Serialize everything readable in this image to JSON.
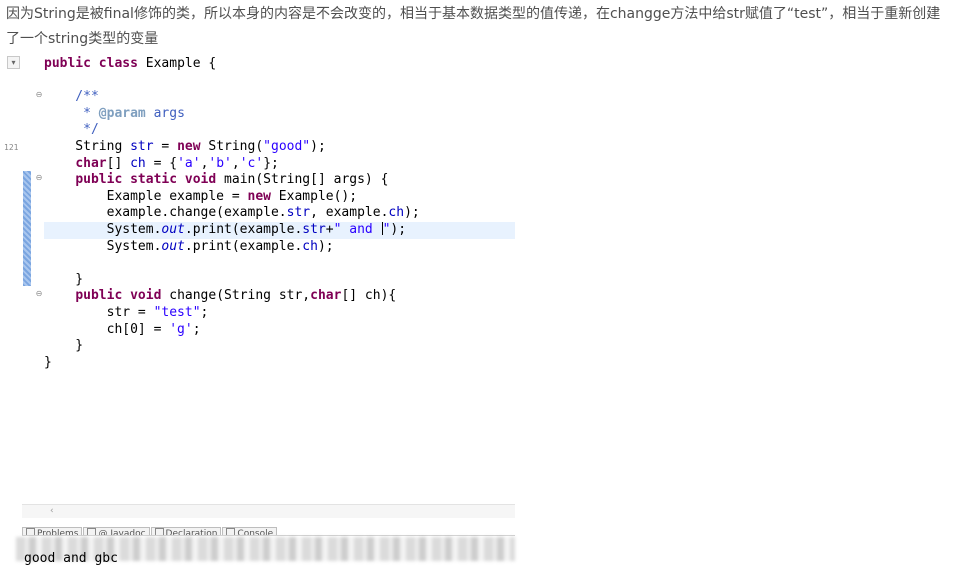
{
  "article": {
    "text": "因为String是被final修饰的类，所以本身的内容是不会改变的，相当于基本数据类型的值传递，在changge方法中给str赋值了“test”，相当于重新创建了一个string类型的变量"
  },
  "ide": {
    "strip_number": "121",
    "code_lines": [
      "public class Example {",
      "",
      "    /**",
      "     * @param args",
      "     */",
      "    String str = new String(\"good\");",
      "    char[] ch = {'a','b','c'};",
      "    public static void main(String[] args) {",
      "        Example example = new Example();",
      "        example.change(example.str, example.ch);",
      "        System.out.print(example.str+\" and \");",
      "        System.out.print(example.ch);",
      "",
      "    }",
      "    public void change(String str,char[] ch){",
      "        str = \"test\";",
      "        ch[0] = 'g';",
      "    }",
      "}"
    ],
    "tabs": [
      "Problems",
      "@ Javadoc",
      "Declaration",
      "Console"
    ],
    "console_output": "good and gbc"
  },
  "colors": {
    "keyword": "#7f0055",
    "string": "#2a00ff",
    "field": "#0000c0",
    "comment": "#3f5fbf",
    "current_line": "#e8f2fe"
  }
}
